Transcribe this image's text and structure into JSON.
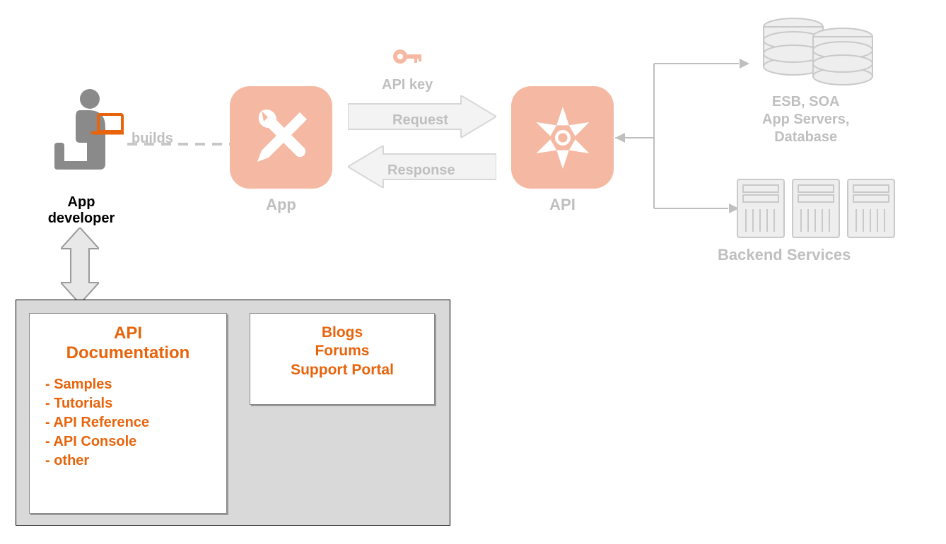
{
  "developer": {
    "label": "App developer"
  },
  "builds_label": "builds",
  "app": {
    "label": "App"
  },
  "api": {
    "label": "API"
  },
  "api_key": "API key",
  "request_label": "Request",
  "response_label": "Response",
  "backend": {
    "databases_line1": "ESB, SOA",
    "databases_line2": "App Servers,",
    "databases_line3": "Database",
    "label": "Backend Services"
  },
  "portal": {
    "doc": {
      "title_line1": "API",
      "title_line2": "Documentation",
      "items": [
        "- Samples",
        "- Tutorials",
        "- API Reference",
        "- API Console",
        "- other"
      ]
    },
    "community": {
      "lines": [
        "Blogs",
        "Forums",
        "Support Portal"
      ]
    }
  }
}
